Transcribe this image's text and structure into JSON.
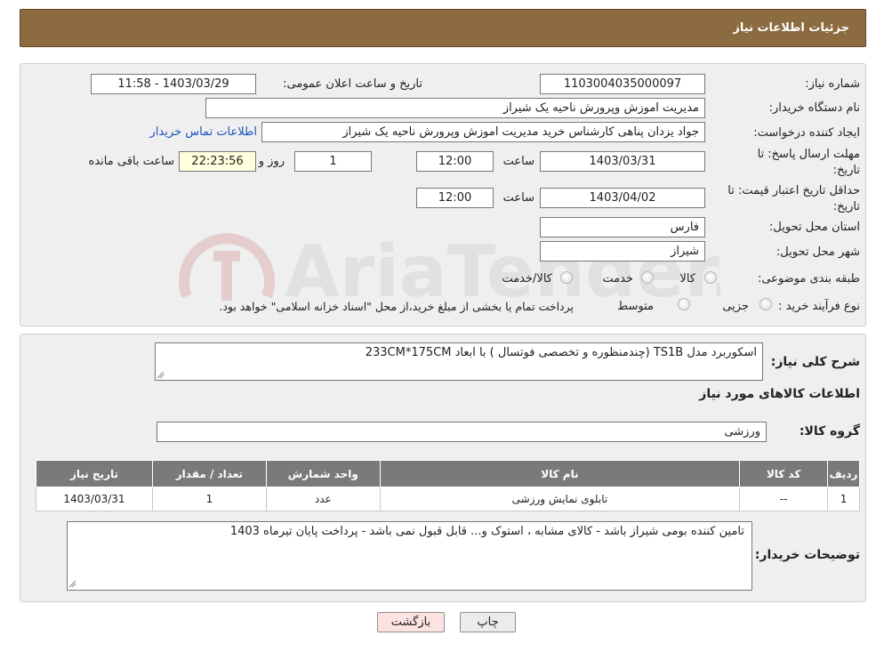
{
  "header": {
    "title": "جزئیات اطلاعات نیاز"
  },
  "form": {
    "need_number_label": "شماره نیاز:",
    "need_number": "1103004035000097",
    "announce_datetime_label": "تاریخ و ساعت اعلان عمومی:",
    "announce_datetime": "1403/03/29 - 11:58",
    "buyer_org_label": "نام دستگاه خریدار:",
    "buyer_org": "مدیریت اموزش وپرورش ناحیه یک شیراز",
    "requester_label": "ایجاد کننده درخواست:",
    "requester": "جواد یزدان پناهی کارشناس خرید مدیریت اموزش وپرورش ناحیه یک شیراز",
    "contact_link": "اطلاعات تماس خریدار",
    "reply_deadline_label_1": "مهلت ارسال پاسخ: تا",
    "reply_deadline_label_2": "تاریخ:",
    "reply_date": "1403/03/31",
    "time_label": "ساعت",
    "reply_time": "12:00",
    "days_value": "1",
    "days_label": "روز و",
    "remaining_time": "22:23:56",
    "remaining_label": "ساعت باقی مانده",
    "validity_label_1": "حداقل تاریخ اعتبار قیمت: تا",
    "validity_label_2": "تاریخ:",
    "validity_date": "1403/04/02",
    "validity_time": "12:00",
    "province_label": "استان محل تحویل:",
    "province": "فارس",
    "city_label": "شهر محل تحویل:",
    "city": "شیراز",
    "category_label": "طبقه بندی موضوعی:",
    "category_options": [
      "کالا",
      "خدمت",
      "کالا/خدمت"
    ],
    "process_label": "نوع فرآیند خرید :",
    "process_options": [
      "جزیی",
      "متوسط"
    ],
    "process_note": "پرداخت تمام یا بخشی از مبلغ خرید،از محل \"اسناد خزانه اسلامی\" خواهد بود."
  },
  "details": {
    "summary_label": "شرح کلی نیاز:",
    "summary": "اسکوربرد مدل TS1B (چندمنظوره و تخصصی فوتسال ) با ابعاد 233CM*175CM",
    "items_heading": "اطلاعات کالاهای مورد نیاز",
    "group_label": "گروه کالا:",
    "group": "ورزشی",
    "table": {
      "headers": [
        "ردیف",
        "کد کالا",
        "نام کالا",
        "واحد شمارش",
        "تعداد / مقدار",
        "تاریخ نیاز"
      ],
      "rows": [
        [
          "1",
          "--",
          "تابلوی نمایش ورزشی",
          "عدد",
          "1",
          "1403/03/31"
        ]
      ]
    },
    "buyer_notes_label": "توضیحات خریدار:",
    "buyer_notes": "تامین کننده بومی شیراز باشد - کالای مشابه ، استوک و... قابل قبول نمی باشد - پرداخت پایان تیرماه 1403"
  },
  "buttons": {
    "print": "چاپ",
    "back": "بازگشت"
  },
  "watermark": {
    "text": "AriaTender.neT"
  },
  "colors": {
    "header_bg": "#8b6b3f",
    "table_header_bg": "#7a7a7a",
    "link": "#1a4fbf",
    "back_button_bg": "#fde2e2"
  }
}
